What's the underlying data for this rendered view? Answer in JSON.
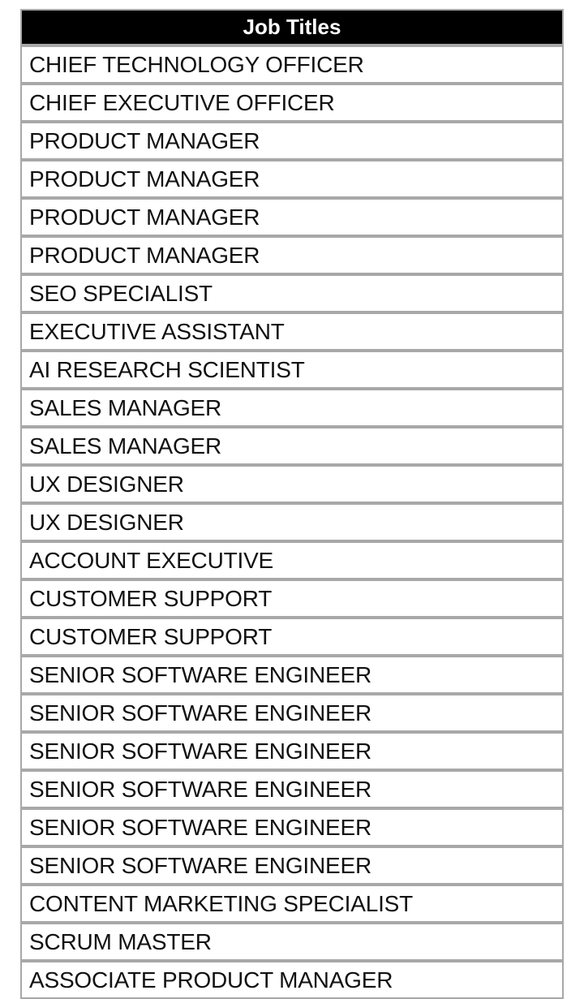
{
  "table": {
    "header": {
      "label": "Job Titles",
      "background_color": "#000000",
      "text_color": "#ffffff"
    },
    "border_color": "#a8a8a8",
    "row_background_color": "#ffffff",
    "row_text_color": "#111111",
    "column_count": 1,
    "row_count": 25,
    "rows": [
      {
        "job_title": "CHIEF TECHNOLOGY OFFICER"
      },
      {
        "job_title": "CHIEF EXECUTIVE OFFICER"
      },
      {
        "job_title": "PRODUCT MANAGER"
      },
      {
        "job_title": "PRODUCT MANAGER"
      },
      {
        "job_title": "PRODUCT MANAGER"
      },
      {
        "job_title": "PRODUCT MANAGER"
      },
      {
        "job_title": "SEO SPECIALIST"
      },
      {
        "job_title": "EXECUTIVE ASSISTANT"
      },
      {
        "job_title": "AI RESEARCH SCIENTIST"
      },
      {
        "job_title": "SALES MANAGER"
      },
      {
        "job_title": "SALES MANAGER"
      },
      {
        "job_title": "UX DESIGNER"
      },
      {
        "job_title": "UX DESIGNER"
      },
      {
        "job_title": "ACCOUNT EXECUTIVE"
      },
      {
        "job_title": "CUSTOMER SUPPORT"
      },
      {
        "job_title": "CUSTOMER SUPPORT"
      },
      {
        "job_title": "SENIOR SOFTWARE ENGINEER"
      },
      {
        "job_title": "SENIOR SOFTWARE ENGINEER"
      },
      {
        "job_title": "SENIOR SOFTWARE ENGINEER"
      },
      {
        "job_title": "SENIOR SOFTWARE ENGINEER"
      },
      {
        "job_title": "SENIOR SOFTWARE ENGINEER"
      },
      {
        "job_title": "SENIOR SOFTWARE ENGINEER"
      },
      {
        "job_title": "CONTENT MARKETING SPECIALIST"
      },
      {
        "job_title": "SCRUM MASTER"
      },
      {
        "job_title": "ASSOCIATE PRODUCT MANAGER"
      }
    ]
  }
}
